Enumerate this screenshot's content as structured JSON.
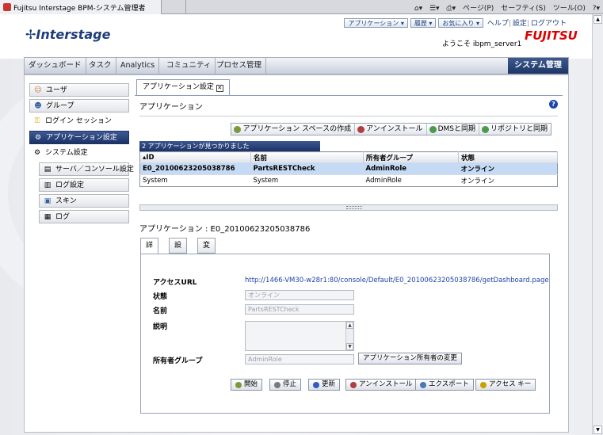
{
  "browser": {
    "tab_title": "Fujitsu Interstage BPM-システム管理者",
    "tools": [
      "ページ(P)",
      "セーフティ(S)",
      "ツール(O)"
    ]
  },
  "header": {
    "logo": "Interstage",
    "dropdowns": [
      "アプリケーション",
      "履歴",
      "お気に入り"
    ],
    "links": [
      "ヘルプ",
      "設定",
      "ログアウト"
    ],
    "welcome": "ようこそ  ibpm_server1",
    "brand": "FUJITSU"
  },
  "nav": {
    "items": [
      "ダッシュボード",
      "タスク",
      "Analytics",
      "コミュニティ",
      "プロセス管理"
    ],
    "system": "システム管理"
  },
  "sidebar": {
    "items": [
      {
        "label": "ユーザ",
        "icon": "user-icon"
      },
      {
        "label": "グループ",
        "icon": "group-icon"
      },
      {
        "label": "ログイン セッション",
        "icon": "key-icon"
      },
      {
        "label": "アプリケーション設定",
        "icon": "app-settings-icon"
      },
      {
        "label": "システム設定",
        "icon": "gear-icon"
      },
      {
        "label": "サーバ／コンソール設定",
        "icon": "server-icon"
      },
      {
        "label": "ログ設定",
        "icon": "log-settings-icon"
      },
      {
        "label": "スキン",
        "icon": "skin-icon"
      },
      {
        "label": "ログ",
        "icon": "log-icon"
      }
    ]
  },
  "content": {
    "tab_label": "アプリケーション設定",
    "section_title": "アプリケーション",
    "toolbar": [
      "アプリケーション スペースの作成",
      "アンインストール",
      "DMSと同期",
      "リポジトリと同期"
    ],
    "found_text": "2 アプリケーションが見つかりました",
    "table": {
      "headers": [
        "ID",
        "名前",
        "所有者グループ",
        "状態"
      ],
      "rows": [
        [
          "E0_20100623205038786",
          "PartsRESTCheck",
          "AdminRole",
          "オンライン"
        ],
        [
          "System",
          "System",
          "AdminRole",
          "オンライン"
        ]
      ]
    },
    "app_title": "アプリケーション : E0_20100623205038786",
    "detail_tabs": [
      "詳細",
      "設定",
      "変数"
    ],
    "detail": {
      "access_url_label": "アクセスURL",
      "access_url": "http://1466-VM30-w28r1:80/console/Default/E0_20100623205038786/getDashboard.page",
      "status_label": "状態",
      "status_value": "オンライン",
      "name_label": "名前",
      "name_value": "PartsRESTCheck",
      "desc_label": "説明",
      "owner_label": "所有者グループ",
      "owner_value": "AdminRole",
      "change_owner": "アプリケーション所有者の変更"
    },
    "buttons": [
      "開始",
      "停止",
      "更新",
      "アンインストール",
      "エクスポート",
      "アクセス キー"
    ]
  },
  "colors": {
    "accent": "#1c3266",
    "selected_row": "#c5daf4",
    "brand": "#dd0000"
  }
}
